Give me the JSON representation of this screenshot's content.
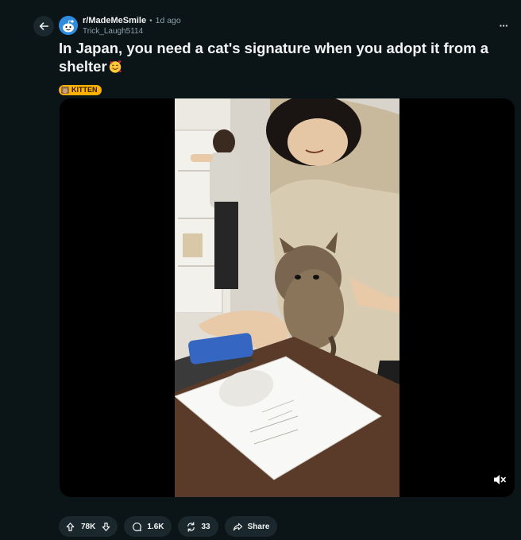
{
  "post": {
    "subreddit": "r/MadeMeSmile",
    "separator": "•",
    "time": "1d ago",
    "username": "Trick_Laugh5114",
    "title": "In Japan, you need a cat's signature when you adopt it from a shelter",
    "title_emoji": "smiling-face-with-hearts",
    "flair": "KITTEN"
  },
  "actions": {
    "upvotes": "78K",
    "comments": "1.6K",
    "crossposts": "33",
    "share_label": "Share"
  },
  "icons": {
    "back": "arrow-left-icon",
    "more": "ellipsis-icon",
    "mute": "speaker-muted-icon",
    "upvote": "arrow-up-icon",
    "downvote": "arrow-down-icon",
    "comment": "chat-bubble-icon",
    "crosspost": "crosspost-icon",
    "share": "share-arrow-icon"
  },
  "colors": {
    "background": "#0b1416",
    "pill": "#1a282d",
    "flair": "#ffb000",
    "subreddit_avatar": "#2d8ce0",
    "muted_text": "#8ba2ad"
  }
}
